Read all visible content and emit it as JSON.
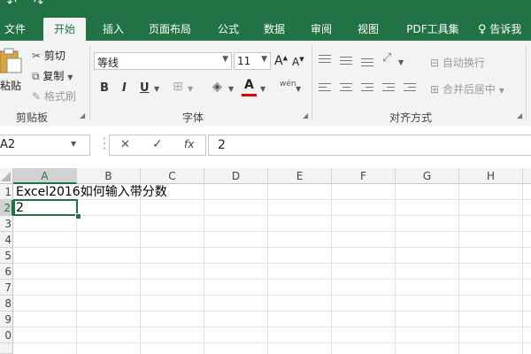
{
  "quick_access": {
    "undo_glyph": "↶",
    "redo_glyph": "↷"
  },
  "tabs": [
    {
      "label": "文件",
      "active": false
    },
    {
      "label": "开始",
      "active": true
    },
    {
      "label": "插入",
      "active": false
    },
    {
      "label": "页面布局",
      "active": false
    },
    {
      "label": "公式",
      "active": false
    },
    {
      "label": "数据",
      "active": false
    },
    {
      "label": "审阅",
      "active": false
    },
    {
      "label": "视图",
      "active": false
    },
    {
      "label": "PDF工具集",
      "active": false
    }
  ],
  "tell_me": "告诉我",
  "clipboard": {
    "paste": "粘贴",
    "cut": "剪切",
    "copy": "复制",
    "format_painter": "格式刷",
    "group_label": "剪贴板"
  },
  "font": {
    "name": "等线",
    "size": "11",
    "grow": "A",
    "shrink": "A",
    "bold": "B",
    "italic": "I",
    "underline": "U",
    "font_color": "A",
    "phonetic": "wén",
    "group_label": "字体"
  },
  "alignment": {
    "wrap_text": "自动换行",
    "merge_center": "合并后居中",
    "group_label": "对齐方式"
  },
  "formula_bar": {
    "name_box": "A2",
    "cancel": "✕",
    "enter": "✓",
    "fx": "fx",
    "value": "2"
  },
  "columns": [
    "A",
    "B",
    "C",
    "D",
    "E",
    "F",
    "G",
    "H"
  ],
  "rows": [
    "1",
    "2",
    "3",
    "4",
    "5",
    "6",
    "7",
    "8",
    "9",
    "0"
  ],
  "cells": {
    "A1": "Excel2016如何输入带分数",
    "A2": "2"
  },
  "colors": {
    "accent": "#217346",
    "font_color_bar": "#e00000"
  }
}
